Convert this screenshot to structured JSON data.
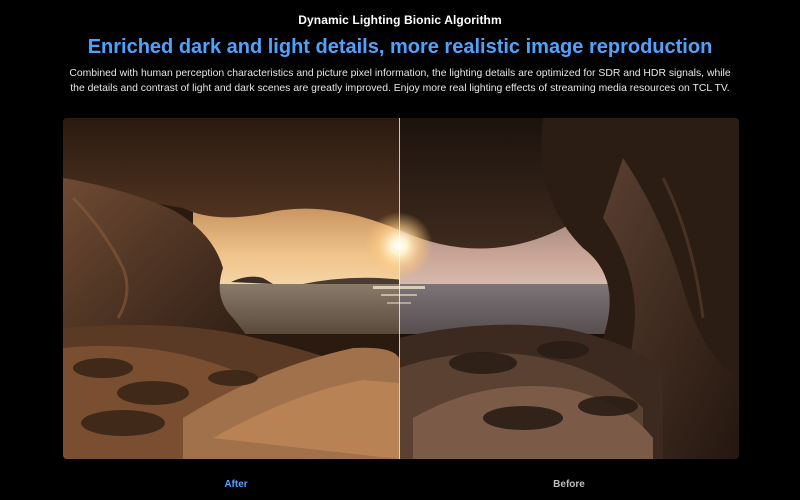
{
  "header": {
    "eyebrow": "Dynamic Lighting Bionic Algorithm",
    "headline": "Enriched dark and light details, more realistic image reproduction",
    "description": "Combined with human perception characteristics and picture pixel information, the lighting details are optimized for SDR and HDR signals, while the details and contrast of light and dark scenes are greatly improved. Enjoy more real lighting effects of streaming media resources on TCL TV."
  },
  "comparison": {
    "image_alt": "Sea cave at sunset",
    "after_label": "After",
    "before_label": "Before"
  },
  "colors": {
    "accent": "#4da3ff",
    "background": "#000000",
    "body_text": "#e6e6e6",
    "inactive_label": "#bdbdbd"
  }
}
